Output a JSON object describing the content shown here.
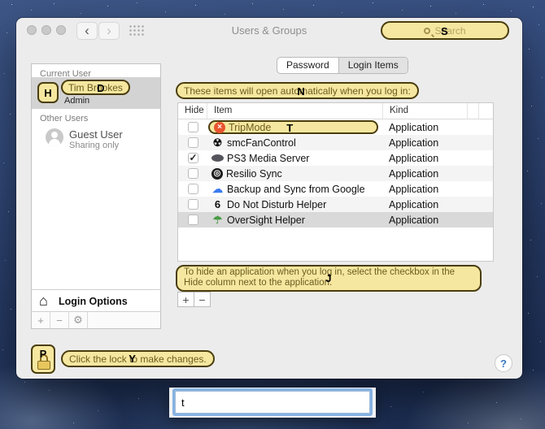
{
  "shortcuts": {
    "search": "S",
    "avatar": "H",
    "user_name": "D",
    "heading": "N",
    "note": "J",
    "lock": "P",
    "lock_text": "Y"
  },
  "window": {
    "title": "Users & Groups",
    "nav": {
      "back": "‹",
      "forward": "›"
    },
    "search": {
      "placeholder": "Search"
    },
    "tabs": [
      {
        "label": "Password",
        "selected": false
      },
      {
        "label": "Login Items",
        "selected": true
      }
    ],
    "sidebar": {
      "current_user_header": "Current User",
      "current_user": {
        "name": "Tim Brookes",
        "role": "Admin"
      },
      "other_users_header": "Other Users",
      "guest_user": {
        "name": "Guest User",
        "role": "Sharing only"
      },
      "login_options_label": "Login Options",
      "login_options_icon": "⌂",
      "toolbar": {
        "add": "+",
        "remove": "−",
        "settings": "⚙"
      }
    },
    "main": {
      "heading": "These items will open automatically when you log in:",
      "table": {
        "columns": [
          "Hide",
          "Item",
          "Kind"
        ],
        "rows": [
          {
            "hide": false,
            "name": "TripMode",
            "kind": "Application",
            "highlighted": true,
            "shortcut": "T",
            "icon": {
              "name": "tripmode-icon",
              "glyph": "×",
              "color": "#ffffff",
              "bg": "#e8542f"
            }
          },
          {
            "hide": false,
            "name": "smcFanControl",
            "kind": "Application",
            "icon": {
              "name": "smcfancontrol-icon",
              "glyph": "☢",
              "color": "#111111"
            }
          },
          {
            "hide": true,
            "name": "PS3 Media Server",
            "kind": "Application",
            "icon": {
              "name": "ps3-media-server-icon",
              "shape": "ellipse",
              "color": "#54555c"
            }
          },
          {
            "hide": false,
            "name": "Resilio Sync",
            "kind": "Application",
            "icon": {
              "name": "resilio-sync-icon",
              "glyph": "◎",
              "color": "#ffffff",
              "bg": "#1c1c1c"
            }
          },
          {
            "hide": false,
            "name": "Backup and Sync from Google",
            "kind": "Application",
            "icon": {
              "name": "backup-and-sync-icon",
              "glyph": "☁",
              "color": "#3a7af0"
            }
          },
          {
            "hide": false,
            "name": "Do Not Disturb Helper",
            "kind": "Application",
            "icon": {
              "name": "do-not-disturb-helper-icon",
              "glyph": "6",
              "color": "#111111"
            }
          },
          {
            "hide": false,
            "name": "OverSight Helper",
            "kind": "Application",
            "selected": true,
            "icon": {
              "name": "oversight-helper-icon",
              "glyph": "☂",
              "color": "#4a9b44"
            }
          }
        ]
      },
      "note": "To hide an application when you log in, select the checkbox in the Hide column next to the application.",
      "list_buttons": {
        "add": "+",
        "remove": "−"
      }
    },
    "footer": {
      "lock_text": "Click the lock to make changes.",
      "help": "?"
    }
  },
  "overlay_input": {
    "value": "t"
  }
}
